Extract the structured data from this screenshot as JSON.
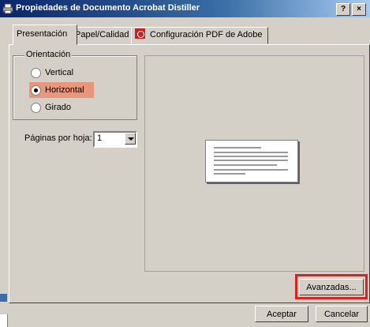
{
  "window": {
    "title": "Propiedades de Documento Acrobat Distiller",
    "help_label": "?",
    "close_label": "×"
  },
  "tabs": [
    {
      "label": "Presentación",
      "active": true
    },
    {
      "label": "Papel/Calidad",
      "active": false
    },
    {
      "label": "Configuración PDF de Adobe",
      "active": false,
      "icon": "adobe-pdf-icon"
    }
  ],
  "orientation": {
    "legend": "Orientación",
    "options": [
      {
        "label": "Vertical",
        "checked": false
      },
      {
        "label": "Horizontal",
        "checked": true
      },
      {
        "label": "Girado",
        "checked": false
      }
    ]
  },
  "pages_per_sheet": {
    "label": "Páginas por hoja:",
    "value": "1"
  },
  "buttons": {
    "advanced": "Avanzadas...",
    "accept": "Aceptar",
    "cancel": "Cancelar"
  },
  "colors": {
    "highlight": "#e9967a",
    "callout_border": "#e0201d",
    "titlebar": "#0a246a"
  }
}
